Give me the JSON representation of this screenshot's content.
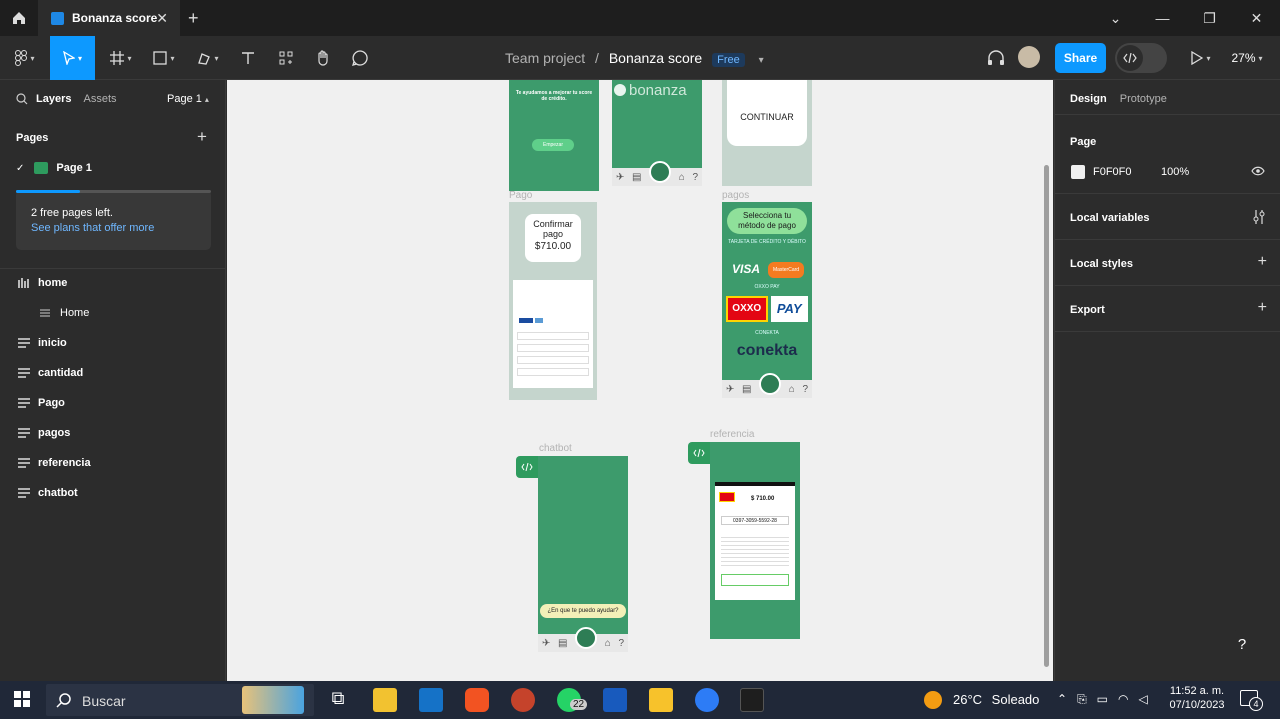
{
  "browser": {
    "tab_title": "Bonanza score",
    "new_tab": "+",
    "close": "✕"
  },
  "toolbar": {
    "project": "Team project",
    "separator": "/",
    "file": "Bonanza score",
    "plan": "Free",
    "share": "Share",
    "zoom": "27%"
  },
  "left_panel": {
    "tabs": [
      "Layers",
      "Assets"
    ],
    "page_selector": "Page 1",
    "pages_title": "Pages",
    "current_page": "Page 1",
    "upsell_line1": "2 free pages left.",
    "upsell_line2": "See plans that offer more",
    "layers": [
      "home",
      "Home",
      "inicio",
      "cantidad",
      "Pago",
      "pagos",
      "referencia",
      "chatbot"
    ]
  },
  "canvas": {
    "labels": {
      "pago": "Pago",
      "pagos": "pagos",
      "chatbot": "chatbot",
      "referencia": "referencia"
    },
    "inicio": {
      "subtitle": "Te ayudamos a mejorar tu score de crédito.",
      "button": "Empezar"
    },
    "home": {
      "logo": "bonanza"
    },
    "cantidad": {
      "button": "CONTINUAR"
    },
    "pago": {
      "confirm": "Confirmar pago",
      "amount": "$710.00"
    },
    "pagos": {
      "title": "Selecciona tu método de pago",
      "card_label": "TARJETA DE CRÉDITO Y DÉBITO",
      "visa": "VISA",
      "mastercard": "MasterCard",
      "oxxo_label": "OXXO PAY",
      "oxxo": "OXXO",
      "pay": "PAY",
      "conekta_label": "CONEKTA",
      "conekta": "conekta"
    },
    "chatbot": {
      "bubble": "¿En que te puedo ayudar?"
    },
    "referencia": {
      "amount": "$ 710.00",
      "reference": "0397-3059-5592-28"
    }
  },
  "right_panel": {
    "tabs": [
      "Design",
      "Prototype"
    ],
    "page_title": "Page",
    "bg_color": "F0F0F0",
    "opacity": "100%",
    "local_variables": "Local variables",
    "local_styles": "Local styles",
    "export": "Export",
    "help": "?"
  },
  "taskbar": {
    "search": "Buscar",
    "weather_temp": "26°C",
    "weather_desc": "Soleado",
    "time": "11:52 a. m.",
    "date": "07/10/2023",
    "whatsapp_badge": "22",
    "notif_count": "4"
  }
}
